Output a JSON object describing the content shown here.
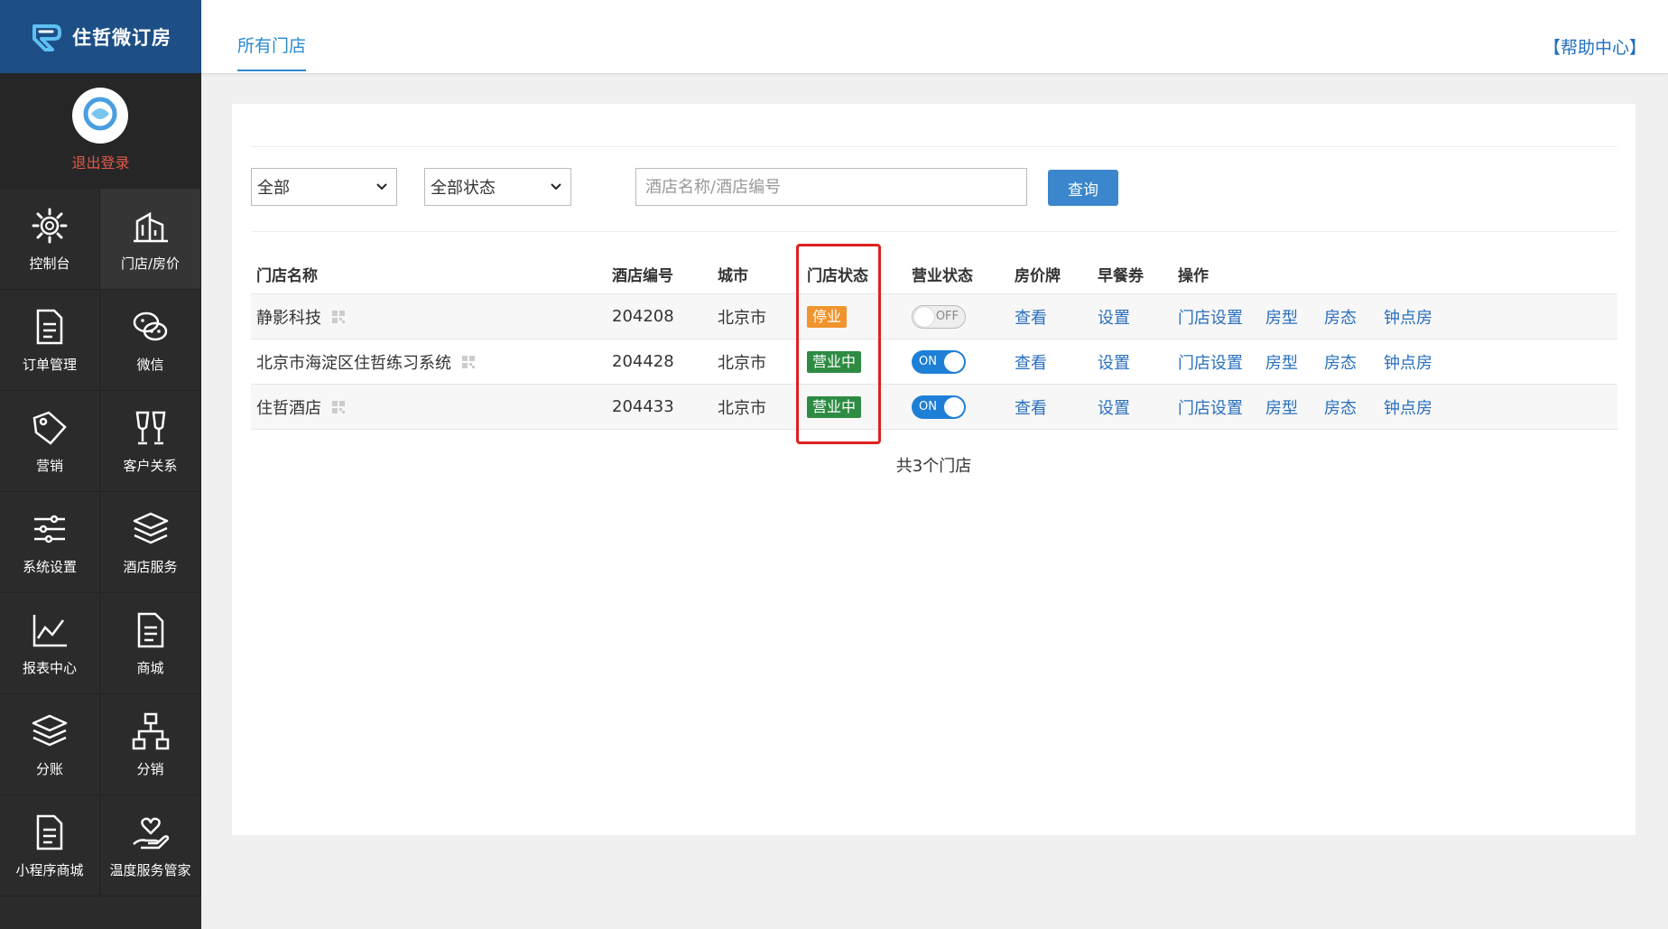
{
  "app": {
    "logo_text": "住哲微订房",
    "logout": "退出登录"
  },
  "sidebar": {
    "items": [
      {
        "label": "控制台",
        "icon": "gear-icon",
        "active": false
      },
      {
        "label": "门店/房价",
        "icon": "building-icon",
        "active": true
      },
      {
        "label": "订单管理",
        "icon": "document-icon",
        "active": false
      },
      {
        "label": "微信",
        "icon": "wechat-icon",
        "active": false
      },
      {
        "label": "营销",
        "icon": "tag-icon",
        "active": false
      },
      {
        "label": "客户关系",
        "icon": "glasses-cheers-icon",
        "active": false
      },
      {
        "label": "系统设置",
        "icon": "sliders-icon",
        "active": false
      },
      {
        "label": "酒店服务",
        "icon": "layers-icon",
        "active": false
      },
      {
        "label": "报表中心",
        "icon": "line-chart-icon",
        "active": false
      },
      {
        "label": "商城",
        "icon": "document-icon",
        "active": false
      },
      {
        "label": "分账",
        "icon": "layers-icon",
        "active": false
      },
      {
        "label": "分销",
        "icon": "org-chart-icon",
        "active": false
      },
      {
        "label": "小程序商城",
        "icon": "document-icon",
        "active": false
      },
      {
        "label": "温度服务管家",
        "icon": "heart-hand-icon",
        "active": false
      }
    ]
  },
  "header": {
    "tab": "所有门店",
    "help": "【帮助中心】"
  },
  "filters": {
    "type_value": "全部",
    "status_value": "全部状态",
    "search_placeholder": "酒店名称/酒店编号",
    "query_button": "查询"
  },
  "table": {
    "columns": [
      "门店名称",
      "酒店编号",
      "城市",
      "门店状态",
      "营业状态",
      "房价牌",
      "早餐券",
      "操作"
    ],
    "rows": [
      {
        "name": "静影科技",
        "code": "204208",
        "city": "北京市",
        "state": "停业",
        "biz": "OFF",
        "price": "查看",
        "breakfast": "设置",
        "ops": [
          "门店设置",
          "房型",
          "房态",
          "钟点房"
        ]
      },
      {
        "name": "北京市海淀区住哲练习系统",
        "code": "204428",
        "city": "北京市",
        "state": "营业中",
        "biz": "ON",
        "price": "查看",
        "breakfast": "设置",
        "ops": [
          "门店设置",
          "房型",
          "房态",
          "钟点房"
        ]
      },
      {
        "name": "住哲酒店",
        "code": "204433",
        "city": "北京市",
        "state": "营业中",
        "biz": "ON",
        "price": "查看",
        "breakfast": "设置",
        "ops": [
          "门店设置",
          "房型",
          "房态",
          "钟点房"
        ]
      }
    ],
    "total": "共3个门店"
  },
  "colors": {
    "sidebar_bg": "#2b2b2b",
    "logo_bar": "#1d4f86",
    "accent": "#2a8ad0",
    "link": "#2a6fbf",
    "stop_badge": "#f0942d",
    "open_badge": "#2e8b43",
    "highlight": "#e02020"
  }
}
